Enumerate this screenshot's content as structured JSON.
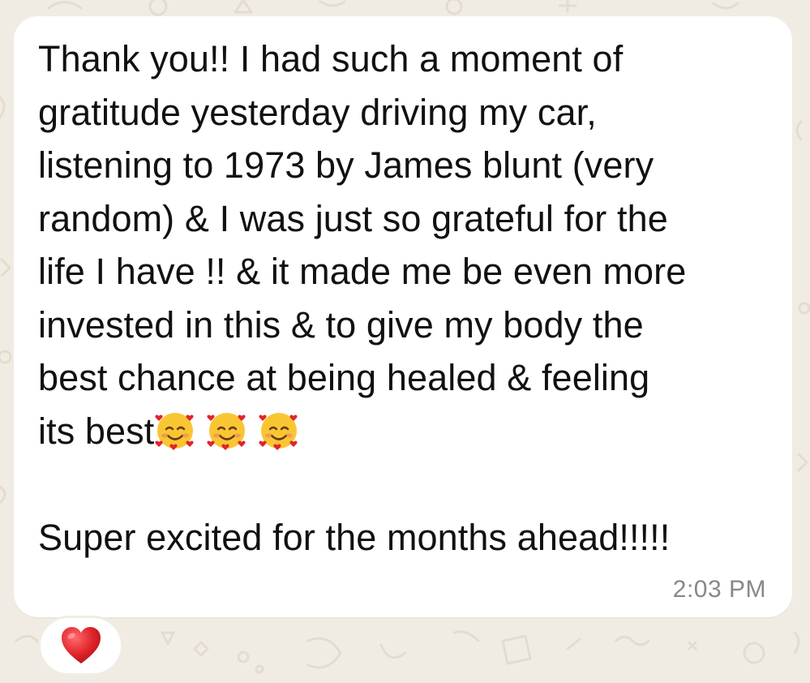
{
  "message": {
    "lines": [
      "Thank you!! I had such a moment of",
      "gratitude yesterday driving my car,",
      "listening to 1973 by James blunt (very",
      "random) & I was just so grateful for the",
      "life I have !! & it made me be even more",
      "invested in this & to give my body the",
      "best chance at being healed & feeling",
      "its best"
    ],
    "emojis": [
      "smiling-face-with-hearts-icon",
      "smiling-face-with-hearts-icon",
      "smiling-face-with-hearts-icon"
    ],
    "closing": "Super excited for the months ahead!!!!!",
    "timestamp": "2:03 PM"
  },
  "reaction": {
    "emoji": "red-heart-icon"
  },
  "colors": {
    "background": "#f1ece3",
    "bubble": "#ffffff",
    "text": "#111111",
    "timestamp": "#888888",
    "heart": "#e0242b"
  }
}
